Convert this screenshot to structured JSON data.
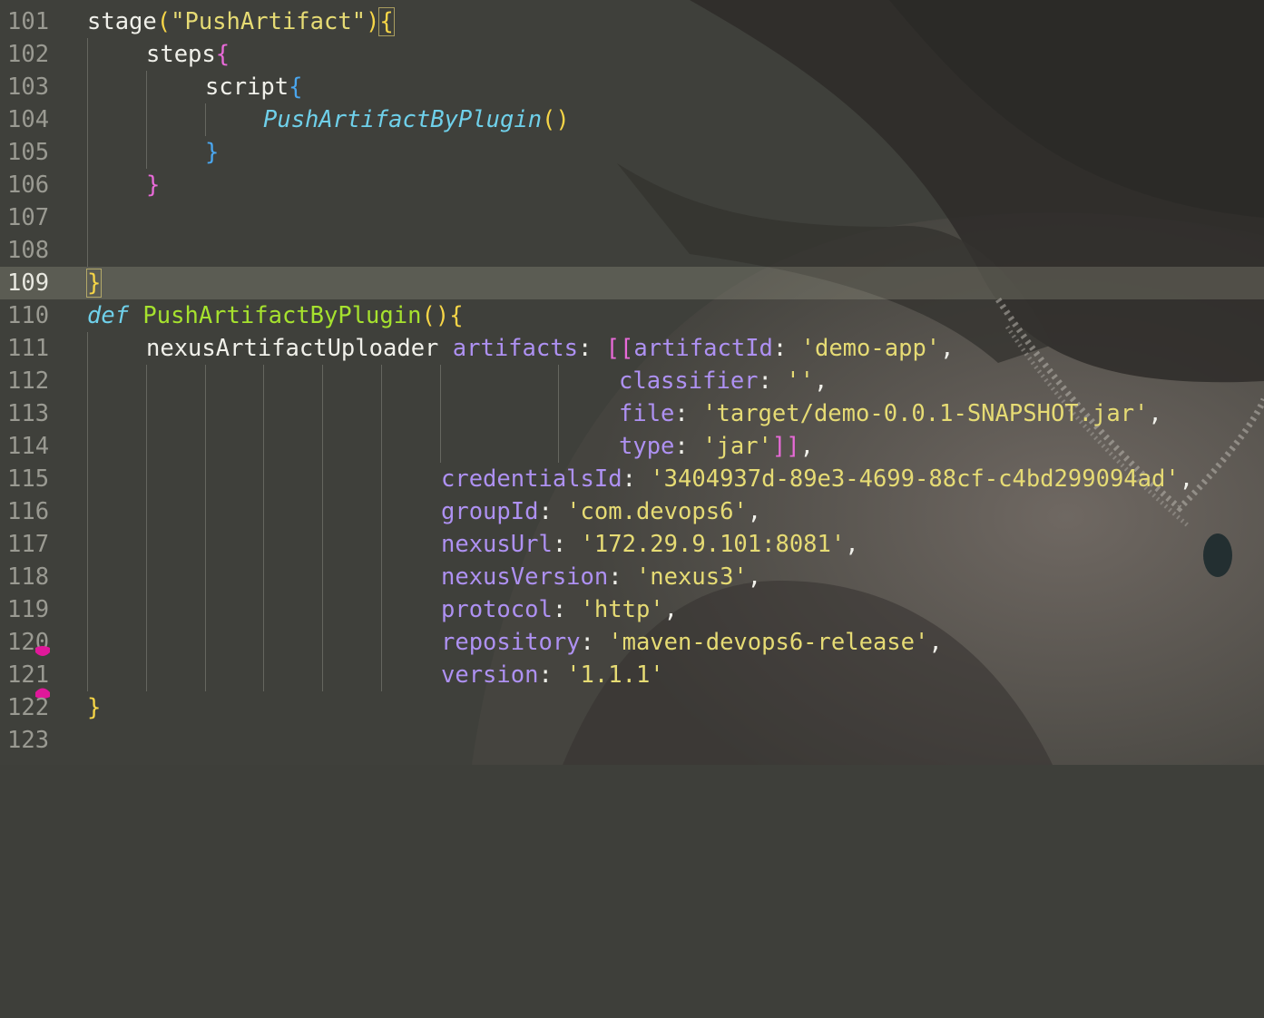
{
  "editor": {
    "line_numbers": [
      "101",
      "102",
      "103",
      "104",
      "105",
      "106",
      "107",
      "108",
      "109",
      "110",
      "111",
      "112",
      "113",
      "114",
      "115",
      "116",
      "117",
      "118",
      "119",
      "120",
      "121",
      "122",
      "123"
    ],
    "current_line": "109",
    "l101": {
      "a": "stage",
      "b": "(",
      "c": "\"PushArtifact\"",
      "d": ")",
      "e": "{"
    },
    "l102": {
      "a": "steps",
      "b": "{"
    },
    "l103": {
      "a": "script",
      "b": "{"
    },
    "l104": {
      "a": "PushArtifactByPlugin",
      "b": "()"
    },
    "l105": {
      "a": "}"
    },
    "l106": {
      "a": "}"
    },
    "l109": {
      "a": "}"
    },
    "l110": {
      "a": "def",
      "b": "PushArtifactByPlugin",
      "c": "()",
      "d": "{"
    },
    "l111": {
      "a": "nexusArtifactUploader",
      "b": "artifacts",
      "c": ": ",
      "d": "[[",
      "e": "artifactId",
      "f": ": ",
      "g": "'demo-app'",
      "h": ","
    },
    "l112": {
      "a": "classifier",
      "b": ": ",
      "c": "''",
      "d": ","
    },
    "l113": {
      "a": "file",
      "b": ": ",
      "c": "'target/demo-0.0.1-SNAPSHOT.jar'",
      "d": ","
    },
    "l114": {
      "a": "type",
      "b": ": ",
      "c": "'jar'",
      "d": "]]",
      "e": ","
    },
    "l115": {
      "a": "credentialsId",
      "b": ": ",
      "c": "'3404937d-89e3-4699-88cf-c4bd299094ad'",
      "d": ","
    },
    "l116": {
      "a": "groupId",
      "b": ": ",
      "c": "'com.devops6'",
      "d": ","
    },
    "l117": {
      "a": "nexusUrl",
      "b": ": ",
      "c": "'172.29.9.101:8081'",
      "d": ","
    },
    "l118": {
      "a": "nexusVersion",
      "b": ": ",
      "c": "'nexus3'",
      "d": ","
    },
    "l119": {
      "a": "protocol",
      "b": ": ",
      "c": "'http'",
      "d": ","
    },
    "l120": {
      "a": "repository",
      "b": ": ",
      "c": "'maven-devops6-release'",
      "d": ","
    },
    "l121": {
      "a": "version",
      "b": ": ",
      "c": "'1.1.1'"
    },
    "l122": {
      "a": "}"
    }
  },
  "colors": {
    "background": "#3e3f3a",
    "string": "#e6db74",
    "property": "#ae91f2",
    "function": "#a6e22e",
    "italic_call": "#6fd0ea",
    "bracket_yellow": "#f6d547",
    "bracket_pink": "#e86ad8",
    "bracket_blue": "#4aa6ee",
    "bookmark_marker": "#e0189a"
  }
}
